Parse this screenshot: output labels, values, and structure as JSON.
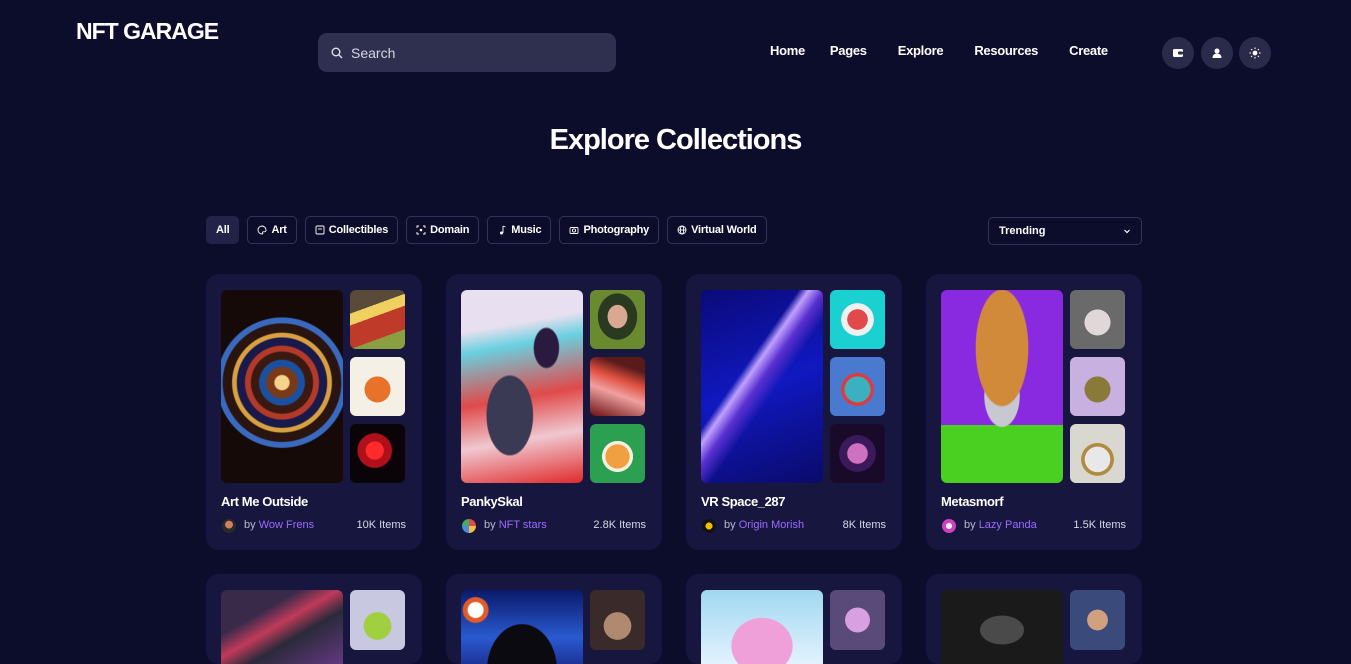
{
  "header": {
    "logo": "NFT GARAGE",
    "search_placeholder": "Search",
    "nav": [
      "Home",
      "Pages",
      "Explore",
      "Resources",
      "Create"
    ],
    "icons": [
      "wallet-icon",
      "user-icon",
      "sun-icon"
    ]
  },
  "page_title": "Explore Collections",
  "filters": [
    {
      "label": "All",
      "icon": "",
      "active": true
    },
    {
      "label": "Art",
      "icon": "palette-icon",
      "active": false
    },
    {
      "label": "Collectibles",
      "icon": "collectibles-icon",
      "active": false
    },
    {
      "label": "Domain",
      "icon": "domain-icon",
      "active": false
    },
    {
      "label": "Music",
      "icon": "music-icon",
      "active": false
    },
    {
      "label": "Photography",
      "icon": "camera-icon",
      "active": false
    },
    {
      "label": "Virtual World",
      "icon": "globe-icon",
      "active": false
    }
  ],
  "sort": {
    "selected": "Trending"
  },
  "collections": [
    {
      "name": "Art Me Outside",
      "by_prefix": "by",
      "creator": "Wow Frens",
      "items": "10K Items"
    },
    {
      "name": "PankySkal",
      "by_prefix": "by",
      "creator": "NFT stars",
      "items": "2.8K Items"
    },
    {
      "name": "VR Space_287",
      "by_prefix": "by",
      "creator": "Origin Morish",
      "items": "8K Items"
    },
    {
      "name": "Metasmorf",
      "by_prefix": "by",
      "creator": "Lazy Panda",
      "items": "1.5K Items"
    }
  ],
  "colors": {
    "background": "#0c0c2b",
    "card": "#16163e",
    "accent": "#9b6cff"
  }
}
